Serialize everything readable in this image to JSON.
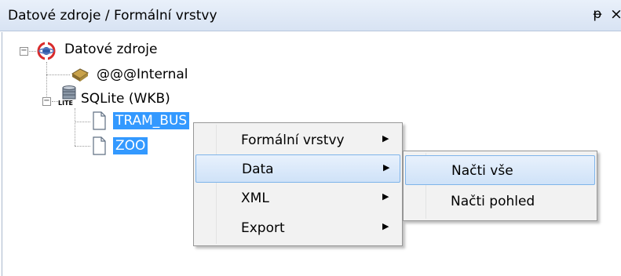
{
  "panel": {
    "title": "Datové zdroje / Formální vrstvy",
    "pin_glyph": "ᵽ",
    "close_glyph": "×"
  },
  "tree": {
    "root": {
      "label": "Datové zdroje",
      "icon": "datasource-icon",
      "expander": "−"
    },
    "internal": {
      "label": "@@@Internal",
      "icon": "cylinder-icon"
    },
    "sqlite": {
      "label": "SQLite (WKB)",
      "icon": "sqlite-db-icon",
      "expander": "−",
      "icon_text": "LITE"
    },
    "layers": [
      {
        "label": "TRAM_BUS",
        "icon": "file-icon",
        "selected": true
      },
      {
        "label": "ZOO",
        "icon": "file-icon",
        "selected": true
      }
    ]
  },
  "context_menu": {
    "items": [
      {
        "label": "Formální vrstvy",
        "has_submenu": true,
        "highlighted": false
      },
      {
        "label": "Data",
        "has_submenu": true,
        "highlighted": true
      },
      {
        "label": "XML",
        "has_submenu": true,
        "highlighted": false
      },
      {
        "label": "Export",
        "has_submenu": true,
        "highlighted": false
      }
    ],
    "arrow_glyph": "▶"
  },
  "submenu": {
    "items": [
      {
        "label": "Načti vše",
        "highlighted": true
      },
      {
        "label": "Načti pohled",
        "highlighted": false
      }
    ]
  },
  "colors": {
    "selection": "#3399ff",
    "menu_highlight_border": "#7eb4ea",
    "titlebar": "#dce6f4"
  }
}
